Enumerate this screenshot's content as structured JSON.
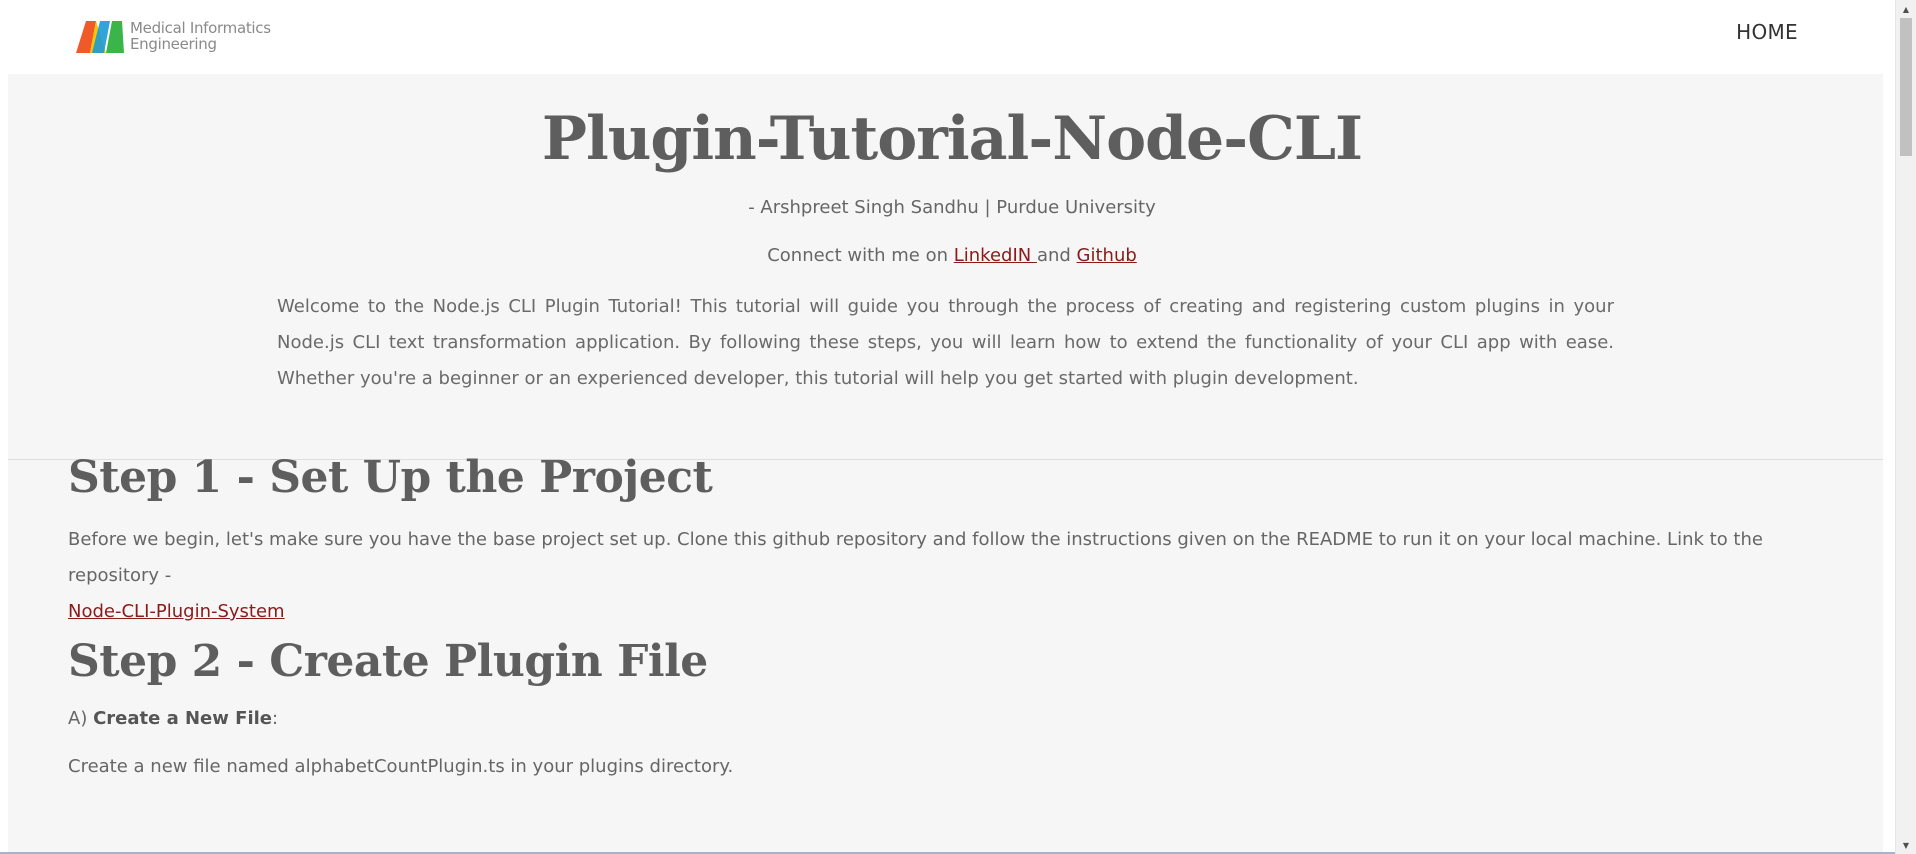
{
  "header": {
    "logo_line1": "Medical Informatics",
    "logo_line2": "Engineering",
    "nav_home": "HOME",
    "colors": {
      "logo_orange": "#f05a28",
      "logo_blue": "#1b9ad6",
      "logo_green": "#39b54a",
      "logo_yellow": "#f7c600"
    }
  },
  "intro": {
    "title": "Plugin-Tutorial-Node-CLI",
    "author": "- Arshpreet Singh Sandhu | Purdue University",
    "connect_prefix": "Connect with me on ",
    "connect_link1": "LinkedIN ",
    "connect_mid": "and ",
    "connect_link2": "Github",
    "welcome": "Welcome to the Node.js CLI Plugin Tutorial! This tutorial will guide you through the process of creating and registering custom plugins in your Node.js CLI text transformation application. By following these steps, you will learn how to extend the functionality of your CLI app with ease. Whether you're a beginner or an experienced developer, this tutorial will help you get started with plugin development."
  },
  "steps": {
    "step1_heading": "Step 1 - Set Up the Project",
    "step1_text": "Before we begin, let's make sure you have the base project set up. Clone this github repository and follow the instructions given on the README to run it on your local machine. Link to the repository - ",
    "step1_link": "Node-CLI-Plugin-System",
    "step2_heading": "Step 2 - Create Plugin File",
    "step2_a_prefix": "A) ",
    "step2_a_bold": "Create a New File",
    "step2_a_suffix": ":",
    "step2_create": "Create a new file named alphabetCountPlugin.ts in your plugins directory."
  },
  "theme": {
    "link_color": "#8b1a1a",
    "content_bg": "#f6f6f6"
  }
}
